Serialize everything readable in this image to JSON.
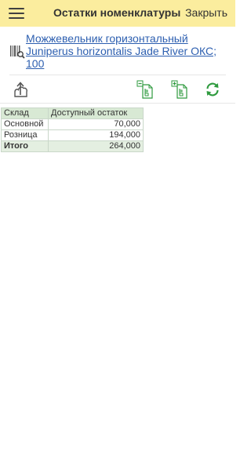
{
  "header": {
    "title": "Остатки номенклатуры",
    "close_label": "Закрыть"
  },
  "item": {
    "name": "Можжевельник горизонтальный Juniperus horizontalis Jade River  ОКС; 100"
  },
  "toolbar": {
    "icons": [
      "upload-icon",
      "collapse-all-icon",
      "expand-all-icon",
      "refresh-icon"
    ]
  },
  "table": {
    "columns": [
      "Склад",
      "Доступный остаток"
    ],
    "rows": [
      [
        "Основной",
        "70,000"
      ],
      [
        "Розница",
        "194,000"
      ]
    ],
    "total": [
      "Итого",
      "264,000"
    ]
  },
  "colors": {
    "header_bg": "#fbed9e",
    "link": "#2d5fb0",
    "table_header_bg": "#d8e9d4",
    "accent_green": "#2e9a3e"
  }
}
